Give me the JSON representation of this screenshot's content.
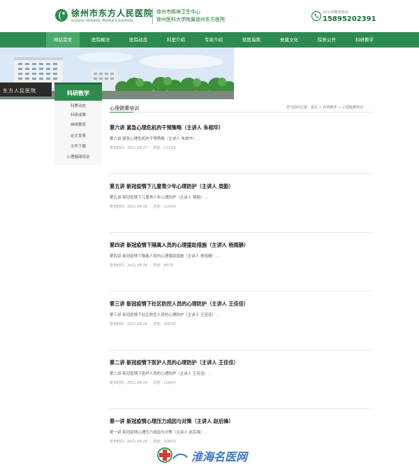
{
  "header": {
    "hospital_name": "徐州市东方人民医院",
    "hospital_name_en": "XUZHOU ORIENTAL PEOPLE'S HOSPITAL",
    "affiliation_1": "徐州市精神卫生中心",
    "affiliation_2": "徐州医科大学附属徐州东方医院",
    "hotline_label": "24小时服务热线",
    "hotline_number": "15895202391",
    "brand_color": "#2e8b4f"
  },
  "nav": {
    "items": [
      {
        "label": "网站首页"
      },
      {
        "label": "医院概况"
      },
      {
        "label": "医院动态"
      },
      {
        "label": "科室介绍"
      },
      {
        "label": "专家介绍"
      },
      {
        "label": "就医指南"
      },
      {
        "label": "党建文化"
      },
      {
        "label": "院务公开"
      },
      {
        "label": "科研教学"
      }
    ],
    "active_index": 0
  },
  "banner": {
    "sign_text": "东方人民医院"
  },
  "sidebar": {
    "title": "科研教学",
    "items": [
      {
        "label": "科教动态"
      },
      {
        "label": "科研成果"
      },
      {
        "label": "继续教育"
      },
      {
        "label": "论文发表"
      },
      {
        "label": "文件下载"
      },
      {
        "label": "心理健康培训"
      }
    ]
  },
  "main": {
    "section_title": "心理健康培训",
    "breadcrumb": "您当前的位置：首页 > 科研教学 > 心理健康培训",
    "articles": [
      {
        "title": "第六讲 紧急心理危机的干预策略（主讲人 朱相华）",
        "summary": "第六讲 紧急心理危机的干预策略（主讲人 朱相华）...",
        "meta": "发布时间：2021-08-27 ｜ 浏览：1313次"
      },
      {
        "title": "第五讲 新冠疫情下儿童青少年心理防护（主讲人 周勤）",
        "summary": "第五讲 新冠疫情下儿童青少年心理防护（主讲人 周勤）...",
        "meta": "发布时间：2021-08-26 ｜ 浏览：2104次"
      },
      {
        "title": "第四讲 新冠疫情下隔离人员的心理援助措施（主讲人 杨雨静）",
        "summary": "第四讲 新冠疫情下隔离人员的心理援助措施（主讲人 杨雨静）...",
        "meta": "发布时间：2021-08-26 ｜ 浏览：897次"
      },
      {
        "title": "第三讲 新冠疫情下社区防控人员的心理防护（主讲人 王佳佳）",
        "summary": "第三讲 新冠疫情下社区防控人员的心理防护（主讲人 王佳佳）...",
        "meta": "发布时间：2021-08-26 ｜ 浏览：1083次"
      },
      {
        "title": "第二讲 新冠疫情下医护人员的心理防护（主讲人 王佳佳）",
        "summary": "第二讲 新冠疫情下医护人员的心理防护（主讲人 王佳佳）...",
        "meta": "发布时间：2021-08-24 ｜ 浏览：1169次"
      },
      {
        "title": "第一讲 新冠疫情心理压力成因与对策（主讲人 赵后锋）",
        "summary": "第一讲 新冠疫情心理压力成因与对策（主讲人 赵后锋）...",
        "meta": "发布时间：2021-08-24 ｜ 浏览：2080次"
      }
    ]
  },
  "watermark": {
    "text": "淮海名医网"
  }
}
